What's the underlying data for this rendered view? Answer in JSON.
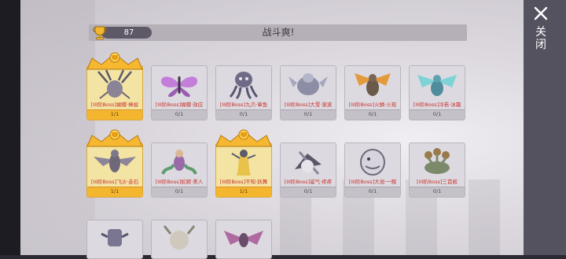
{
  "header": {
    "score": "87",
    "title": "战斗爽!"
  },
  "close": {
    "label": "关闭",
    "icon": "close-icon"
  },
  "bosses": [
    {
      "name": "[III阶Boss]蝴蝶·棒蚁",
      "count": "1/1",
      "unlocked": true
    },
    {
      "name": "[III阶Boss]蝴蝶·效应",
      "count": "0/1",
      "unlocked": false
    },
    {
      "name": "[III阶Boss]九爪·章鱼",
      "count": "0/1",
      "unlocked": false
    },
    {
      "name": "[III阶Boss]大雪·滚滚",
      "count": "0/1",
      "unlocked": false
    },
    {
      "name": "[III阶Boss]火鳞·火现",
      "count": "0/1",
      "unlocked": false
    },
    {
      "name": "[III阶Boss]冷若·冰霜",
      "count": "0/1",
      "unlocked": false
    },
    {
      "name": "[III阶Boss]飞沙·走石",
      "count": "1/1",
      "unlocked": true
    },
    {
      "name": "[III阶Boss]蛇姬·美人",
      "count": "0/1",
      "unlocked": false
    },
    {
      "name": "[III阶Boss]不知·跃舞",
      "count": "1/1",
      "unlocked": true
    },
    {
      "name": "[III阶Boss]鲨气·疼疼",
      "count": "0/1",
      "unlocked": false
    },
    {
      "name": "[III阶Boss]大池·一鲸",
      "count": "0/1",
      "unlocked": false
    },
    {
      "name": "[III阶Boss]三首蛟",
      "count": "0/1",
      "unlocked": false
    }
  ],
  "colors": {
    "gold": "#f4b52f",
    "name_red": "#c9302c",
    "panel": "#55525f"
  }
}
